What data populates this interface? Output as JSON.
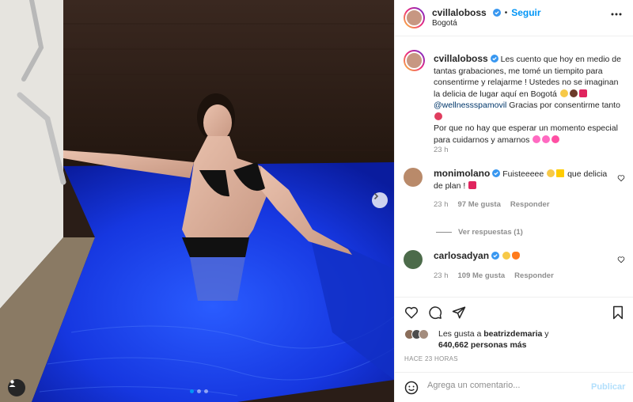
{
  "colors": {
    "accent": "#0095f6",
    "verified": "#3897f0",
    "like_red": "#ed4956",
    "muted": "#8e8e8e",
    "pool_blue": "#1a3cf5"
  },
  "post": {
    "carousel_dots": 3,
    "active_dot": 0,
    "user_tag_icon": "user-icon",
    "next_icon": "chevron-right-icon"
  },
  "header": {
    "username": "cvillaloboss",
    "separator": "•",
    "follow_label": "Seguir",
    "location": "Bogotá",
    "more_icon": "more-horizontal-icon"
  },
  "caption": {
    "username": "cvillaloboss",
    "text_1": "Les cuento que hoy en medio de tantas grabaciones, me tomé un tiempito para consentirme y relajarme ! Ustedes no se imaginan la delicia de lugar aquí en Bogotá",
    "mention": "@wellnessspamovil",
    "text_2": "Gracias por consentirme tanto",
    "text_3": "Por que no hay que esperar un momento especial para cuidarnos y amarnos",
    "time": "23 h"
  },
  "comments": [
    {
      "username": "monimolano",
      "text": "Fuisteeeee",
      "text_after": "que delicia de plan !",
      "time": "23 h",
      "likes": "97 Me gusta",
      "reply": "Responder"
    },
    {
      "username": "carlosadyan",
      "text": "",
      "time": "23 h",
      "likes": "109 Me gusta",
      "reply": "Responder"
    }
  ],
  "view_replies": "Ver respuestas (1)",
  "actions": {
    "like_icon": "heart-icon",
    "comment_icon": "comment-icon",
    "share_icon": "share-icon",
    "save_icon": "bookmark-icon"
  },
  "likes": {
    "prefix": "Les gusta a",
    "user": "beatrizdemaria",
    "joiner": "y",
    "count": "640,662 personas más"
  },
  "time_ago": "HACE 23 HORAS",
  "comment_box": {
    "emoji_icon": "smiley-icon",
    "placeholder": "Agrega un comentario...",
    "publish_label": "Publicar"
  }
}
